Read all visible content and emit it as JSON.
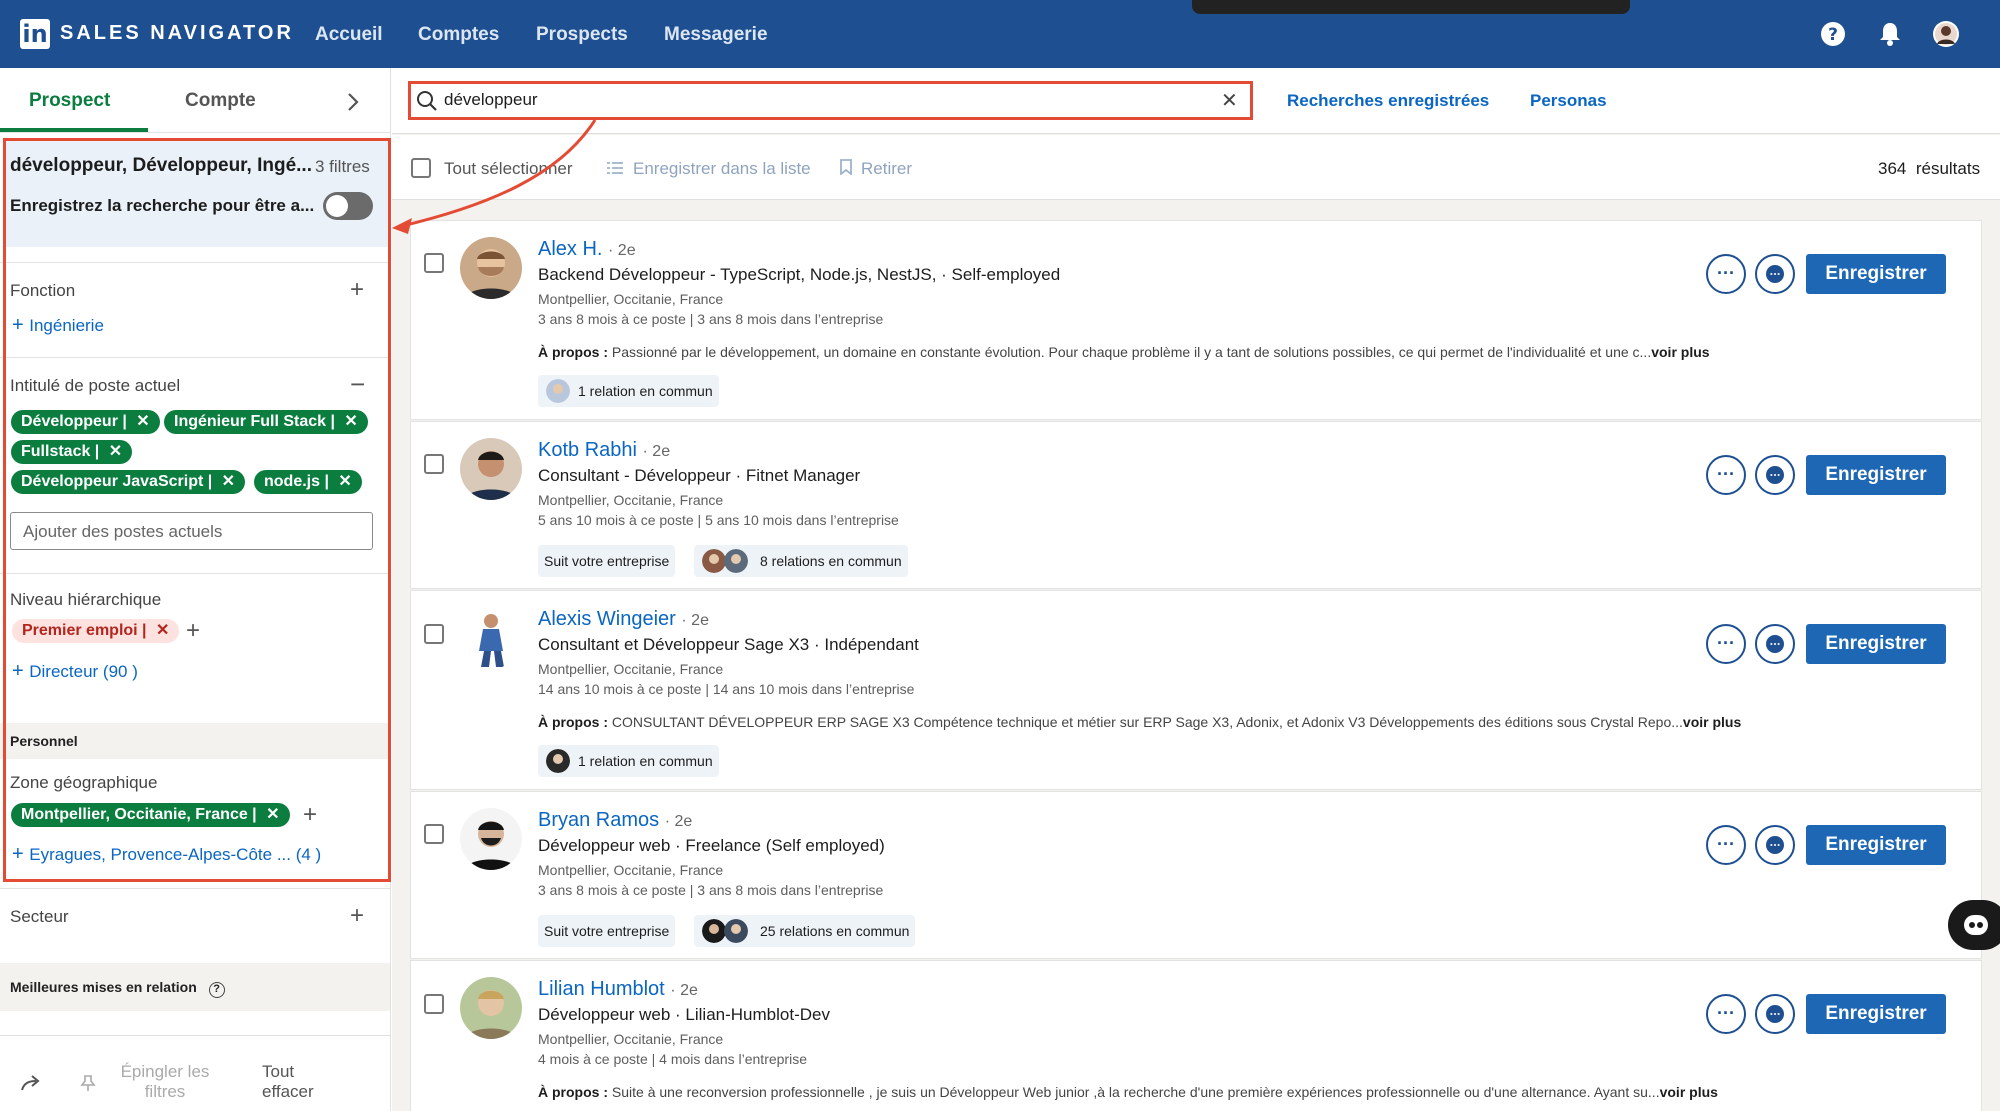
{
  "topbar": {
    "brand": "SALES NAVIGATOR",
    "logo": "in",
    "nav": [
      "Accueil",
      "Comptes",
      "Prospects",
      "Messagerie"
    ],
    "icons": [
      "help-icon",
      "bell-icon",
      "avatar"
    ]
  },
  "left": {
    "tabs": {
      "prospect": "Prospect",
      "compte": "Compte"
    },
    "summary": {
      "title": "développeur, Développeur, Ingé...",
      "count": "3 filtres",
      "save": "Enregistrez la recherche pour être a..."
    },
    "fonction": {
      "label": "Fonction",
      "link": "Ingénierie"
    },
    "intitule": {
      "label": "Intitulé de poste actuel",
      "chips": [
        "Développeur",
        "Ingénieur Full Stack",
        "Fullstack",
        "Développeur JavaScript",
        "node.js"
      ],
      "placeholder": "Ajouter des postes actuels"
    },
    "niveau": {
      "label": "Niveau hiérarchique",
      "chip": "Premier emploi",
      "link": "Directeur (90 )"
    },
    "personnel": "Personnel",
    "zone": {
      "label": "Zone géographique",
      "chip": "Montpellier, Occitanie, France",
      "link": "Eyragues, Provence-Alpes-Côte ... (4 )"
    },
    "secteur": "Secteur",
    "meilleures": "Meilleures mises en relation",
    "bottom": {
      "pin": "Épingler les filtres",
      "clear": "Tout effacer"
    }
  },
  "search": {
    "value": "développeur",
    "saved": "Recherches enregistrées",
    "personas": "Personas"
  },
  "toolbar": {
    "select_all": "Tout sélectionner",
    "save_list": "Enregistrer dans la liste",
    "remove": "Retirer",
    "results_count": "364",
    "results_label": "résultats"
  },
  "results": [
    {
      "name": "Alex H.",
      "degree": "· 2e",
      "title": "Backend Développeur - TypeScript, Node.js, NestJS, · Self-employed",
      "location": "Montpellier, Occitanie, France",
      "tenure": "3 ans 8 mois à ce poste | 3 ans 8 mois dans l’entreprise",
      "about_label": "À propos :",
      "about": "Passionné par le développement, un domaine en constante évolution. Pour chaque problème il y a tant de solutions possibles, ce qui permet de l'individualité et une c...",
      "more": "voir plus",
      "badges": [
        "1 relation en commun"
      ]
    },
    {
      "name": "Kotb Rabhi",
      "degree": "· 2e",
      "title": "Consultant - Développeur · Fitnet Manager",
      "location": "Montpellier, Occitanie, France",
      "tenure": "5 ans 10 mois à ce poste | 5 ans 10 mois dans l’entreprise",
      "follow": "Suit votre entreprise",
      "badges": [
        "8 relations en commun"
      ]
    },
    {
      "name": "Alexis Wingeier",
      "degree": "· 2e",
      "title": "Consultant et Développeur Sage X3 · Indépendant",
      "location": "Montpellier, Occitanie, France",
      "tenure": "14 ans 10 mois à ce poste | 14 ans 10 mois dans l’entreprise",
      "about_label": "À propos :",
      "about": "CONSULTANT DÉVELOPPEUR ERP SAGE X3 Compétence technique et métier sur ERP Sage X3, Adonix, et Adonix V3 Développements des éditions sous Crystal Repo...",
      "more": "voir plus",
      "badges": [
        "1 relation en commun"
      ]
    },
    {
      "name": "Bryan Ramos",
      "degree": "· 2e",
      "title": "Développeur web · Freelance (Self employed)",
      "location": "Montpellier, Occitanie, France",
      "tenure": "3 ans 8 mois à ce poste | 3 ans 8 mois dans l’entreprise",
      "follow": "Suit votre entreprise",
      "badges": [
        "25 relations en commun"
      ]
    },
    {
      "name": "Lilian Humblot",
      "degree": "· 2e",
      "title": "Développeur web · Lilian-Humblot-Dev",
      "location": "Montpellier, Occitanie, France",
      "tenure": "4 mois à ce poste | 4 mois dans l’entreprise",
      "about_label": "À propos :",
      "about": "Suite à une reconversion professionnelle , je suis un Développeur Web junior ,à la recherche d'une première expériences professionnelle ou d'une alternance. Ayant su...",
      "more": "voir plus"
    }
  ],
  "save_button": "Enregistrer",
  "colors": {
    "brand": "#1d4f91",
    "accent_green": "#0a7d3f",
    "highlight": "#e34b35",
    "link": "#0a66c2"
  }
}
